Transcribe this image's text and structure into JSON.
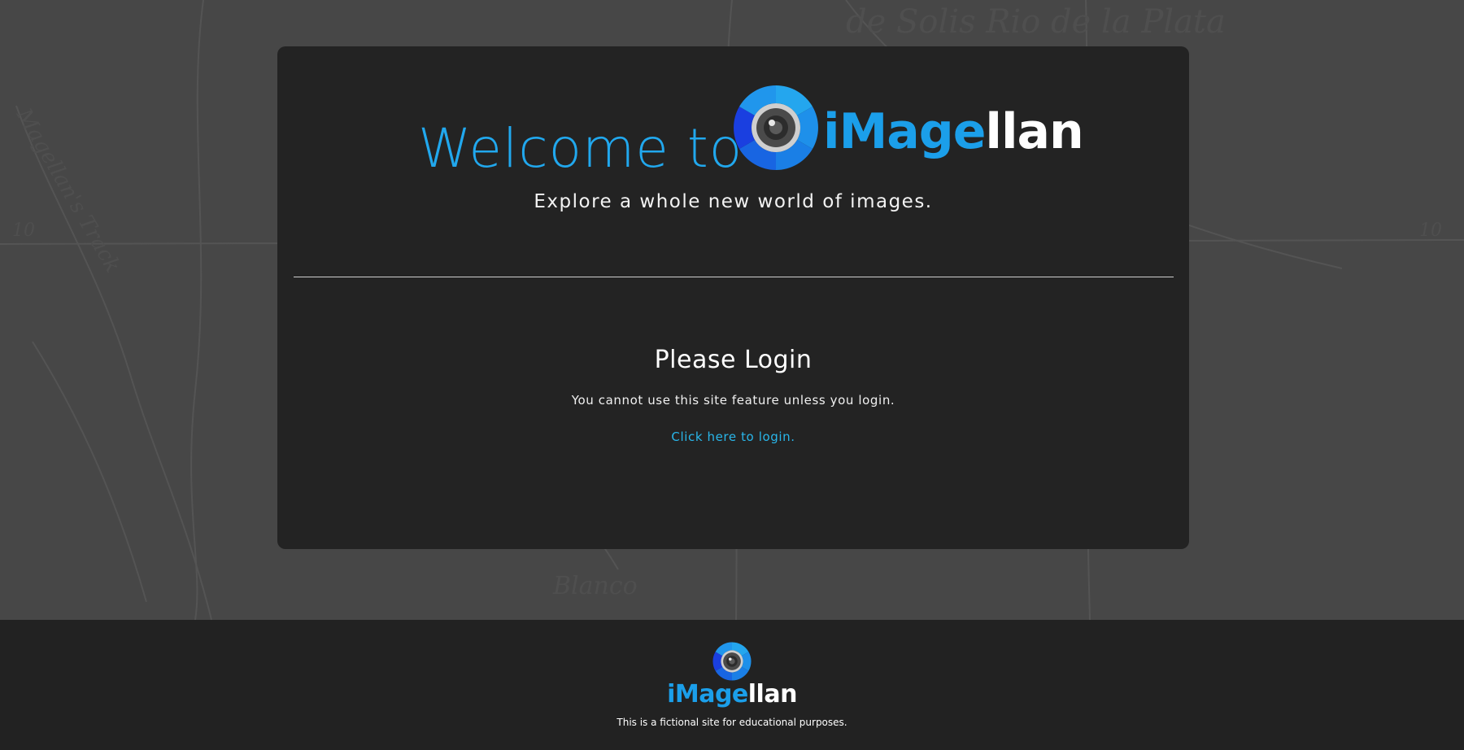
{
  "hero": {
    "welcome_text": "Welcome to",
    "logo_part_blue": "iMage",
    "logo_part_white": "llan",
    "logo_icon": "camera-aperture-icon",
    "tagline": "Explore a whole new world of images."
  },
  "login": {
    "title": "Please Login",
    "message": "You cannot use this site feature unless you login.",
    "link_label": "Click here to login."
  },
  "footer": {
    "logo_part_blue": "iMage",
    "logo_part_white": "llan",
    "logo_icon": "camera-aperture-icon",
    "note": "This is a fictional site for educational purposes."
  },
  "colors": {
    "brand_blue": "#21a8ee",
    "link_blue": "#29b6ea",
    "panel_background": "#232323",
    "page_background": "#474747",
    "footer_background": "#222222"
  }
}
